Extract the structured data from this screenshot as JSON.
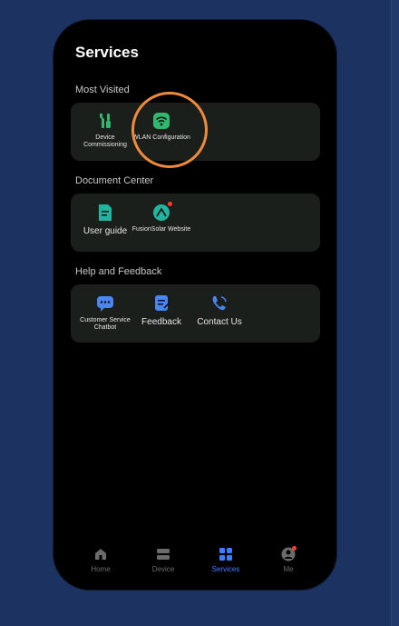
{
  "page_title": "Services",
  "sections": [
    {
      "title": "Most Visited",
      "items": [
        {
          "label": "Device Commissioning",
          "icon": "wrench-screwdriver-icon"
        },
        {
          "label": "WLAN Configuration",
          "icon": "wifi-icon"
        }
      ]
    },
    {
      "title": "Document Center",
      "items": [
        {
          "label": "User guide",
          "icon": "document-icon"
        },
        {
          "label": "FusionSolar Website",
          "icon": "fusionsolar-icon"
        }
      ]
    },
    {
      "title": "Help and Feedback",
      "items": [
        {
          "label": "Customer Service Chatbot",
          "icon": "chat-icon"
        },
        {
          "label": "Feedback",
          "icon": "feedback-icon"
        },
        {
          "label": "Contact Us",
          "icon": "phone-icon"
        }
      ]
    }
  ],
  "tabs": [
    {
      "label": "Home",
      "icon": "home-icon",
      "active": false
    },
    {
      "label": "Device",
      "icon": "device-icon",
      "active": false
    },
    {
      "label": "Services",
      "icon": "services-icon",
      "active": true
    },
    {
      "label": "Me",
      "icon": "profile-icon",
      "active": false
    }
  ],
  "colors": {
    "accent": "#3d7dff",
    "icon_green": "#2fb86e",
    "icon_teal": "#1fb5a0",
    "icon_blue": "#4b86f0",
    "highlight": "#f08a3c"
  }
}
